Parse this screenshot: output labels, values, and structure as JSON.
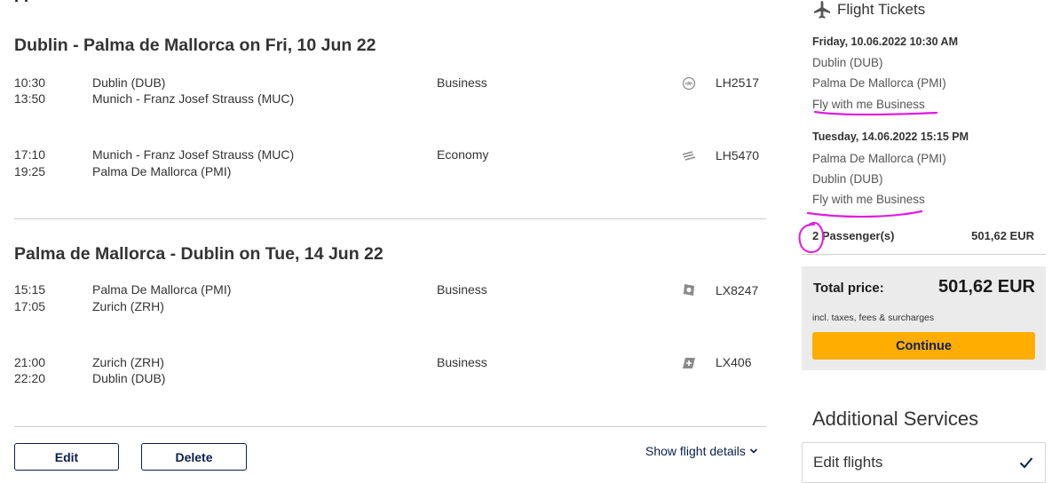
{
  "itinerary": {
    "cut_heading": "Fl",
    "legs": [
      {
        "title": "Dublin - Palma de Mallorca on Fri, 10 Jun 22",
        "segments": [
          {
            "dep_time": "10:30",
            "arr_time": "13:50",
            "from": "Dublin (DUB)",
            "to": "Munich - Franz Josef Strauss (MUC)",
            "cabin": "Business",
            "carrier_icon": "lufthansa-crane-icon",
            "flight_no": "LH2517"
          },
          {
            "dep_time": "17:10",
            "arr_time": "19:25",
            "from": "Munich - Franz Josef Strauss (MUC)",
            "to": "Palma De Mallorca (PMI)",
            "cabin": "Economy",
            "carrier_icon": "eurowings-icon",
            "flight_no": "LH5470"
          }
        ]
      },
      {
        "title": "Palma de Mallorca - Dublin on Tue, 14 Jun 22",
        "segments": [
          {
            "dep_time": "15:15",
            "arr_time": "17:05",
            "from": "Palma De Mallorca (PMI)",
            "to": "Zurich (ZRH)",
            "cabin": "Business",
            "carrier_icon": "edelweiss-icon",
            "flight_no": "LX8247"
          },
          {
            "dep_time": "21:00",
            "arr_time": "22:20",
            "from": "Zurich (ZRH)",
            "to": "Dublin (DUB)",
            "cabin": "Business",
            "carrier_icon": "swiss-icon",
            "flight_no": "LX406"
          }
        ]
      }
    ],
    "edit_label": "Edit",
    "delete_label": "Delete",
    "details_link": "Show flight details"
  },
  "summary": {
    "heading": "Flight Tickets",
    "outbound": {
      "datetime": "Friday, 10.06.2022 10:30 AM",
      "from": "Dublin (DUB)",
      "to": "Palma De Mallorca (PMI)",
      "fare": "Fly with me Business"
    },
    "inbound": {
      "datetime": "Tuesday, 14.06.2022 15:15 PM",
      "from": "Palma De Mallorca (PMI)",
      "to": "Dublin (DUB)",
      "fare": "Fly with me Business"
    },
    "passengers_count": "2",
    "passengers_label": " Passenger(s)",
    "passengers_price": "501,62 EUR",
    "total_label": "Total price:",
    "total_value": "501,62 EUR",
    "total_note": "incl. taxes, fees & surcharges",
    "continue_label": "Continue"
  },
  "additional": {
    "heading": "Additional Services",
    "edit_flights_label": "Edit flights"
  },
  "colors": {
    "brand_navy": "#0b1f4d",
    "continue_yellow": "#ffad00",
    "annotation_magenta": "#e11ce1",
    "total_box_gray": "#ebebeb"
  }
}
